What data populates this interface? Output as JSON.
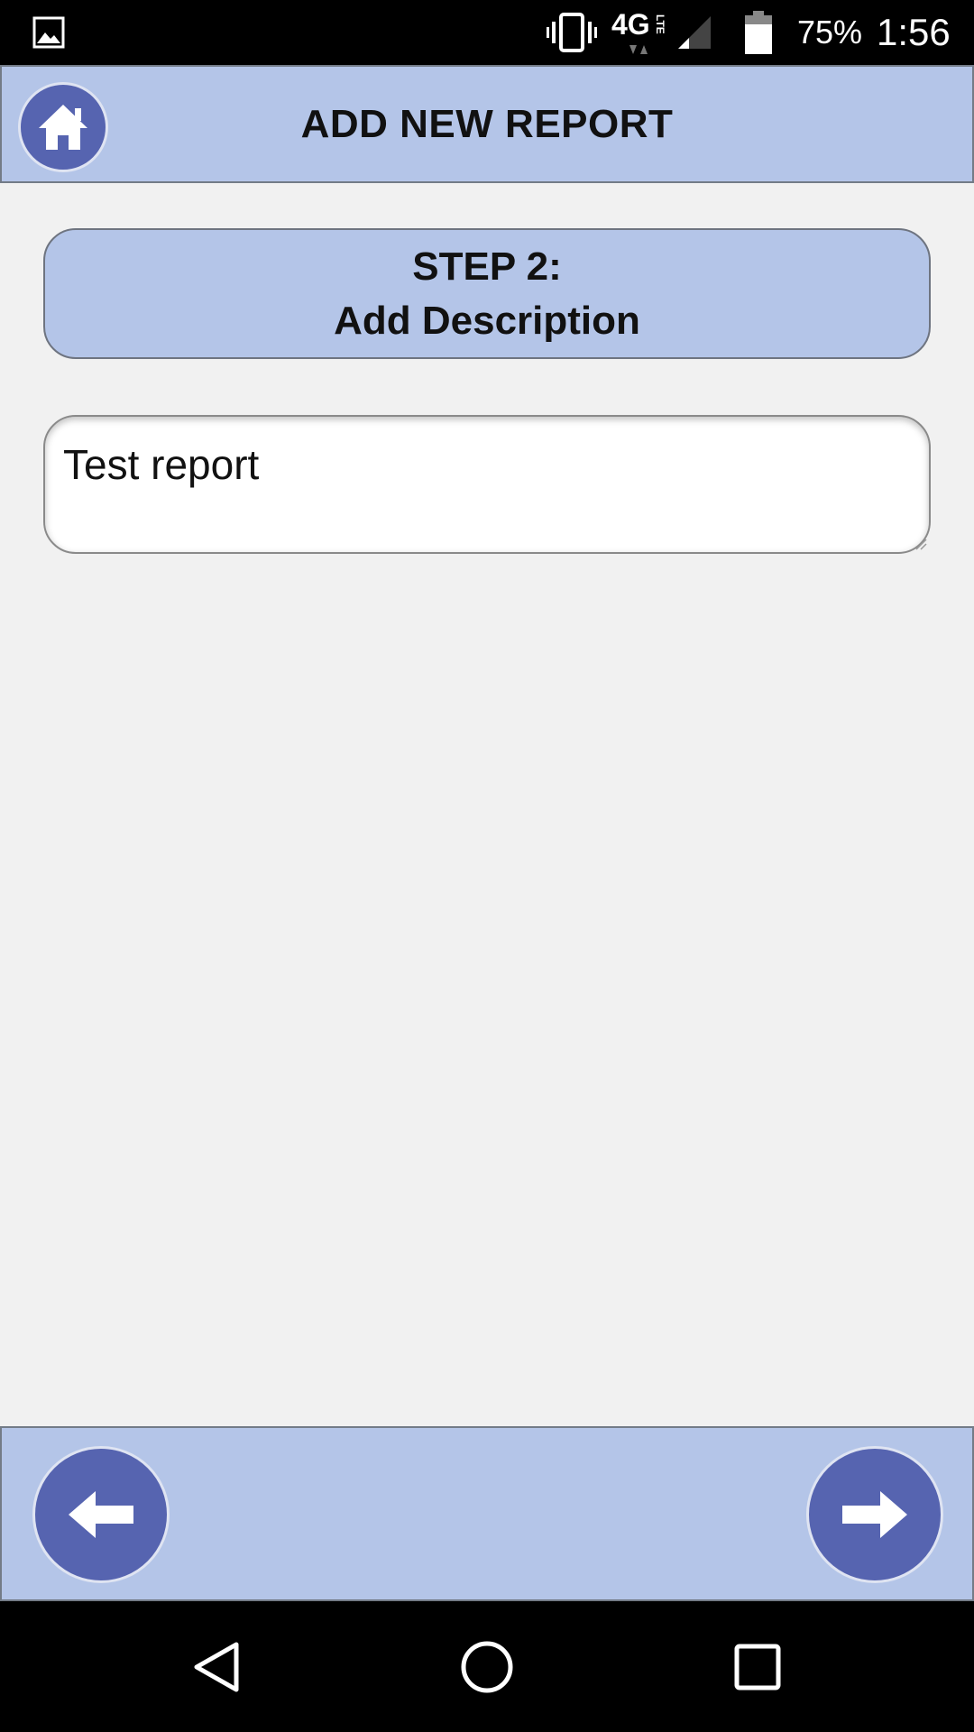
{
  "status_bar": {
    "battery_percent": "75%",
    "time": "1:56",
    "network": "4G LTE",
    "icons": [
      "gallery-icon",
      "vibrate-icon",
      "network-4g-lte-icon",
      "signal-icon",
      "battery-icon"
    ]
  },
  "header": {
    "title": "ADD NEW REPORT",
    "home_icon": "home-icon"
  },
  "step": {
    "line1": "STEP 2:",
    "line2": "Add Description"
  },
  "description": {
    "value": "Test report"
  },
  "footer": {
    "back_icon": "arrow-left-icon",
    "next_icon": "arrow-right-icon"
  },
  "android_nav": {
    "icons": [
      "back-triangle-icon",
      "home-circle-icon",
      "recents-square-icon"
    ]
  },
  "colors": {
    "bar_bg": "#b4c5e8",
    "button_bg": "#5664b0",
    "page_bg": "#f1f1f1",
    "border": "#737b87"
  }
}
